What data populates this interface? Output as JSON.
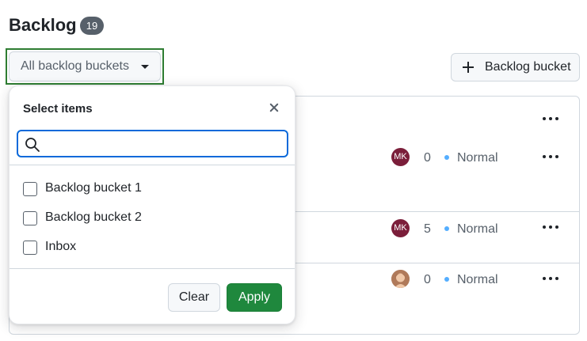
{
  "header": {
    "title": "Backlog",
    "count": "19"
  },
  "toolbar": {
    "filter_label": "All backlog buckets",
    "add_label": "Backlog bucket"
  },
  "rows": [
    {
      "avatar": "",
      "count": "",
      "priority": ""
    },
    {
      "avatar": "MK",
      "count": "0",
      "priority": "Normal"
    },
    {
      "avatar": "MK",
      "count": "5",
      "priority": "Normal"
    },
    {
      "avatar": "photo",
      "count": "0",
      "priority": "Normal"
    }
  ],
  "popover": {
    "title": "Select items",
    "search_placeholder": "",
    "options": [
      {
        "label": "Backlog bucket 1",
        "checked": false
      },
      {
        "label": "Backlog bucket 2",
        "checked": false
      },
      {
        "label": "Inbox",
        "checked": false
      }
    ],
    "clear_label": "Clear",
    "apply_label": "Apply"
  },
  "colors": {
    "accent_green": "#1f883d",
    "focus_blue": "#0969da",
    "avatar_maroon": "#7b1e3a",
    "priority_dot": "#54aeff"
  },
  "icons": [
    "plus-icon",
    "caret-down-icon",
    "more-horizontal-icon",
    "search-icon",
    "close-icon"
  ]
}
